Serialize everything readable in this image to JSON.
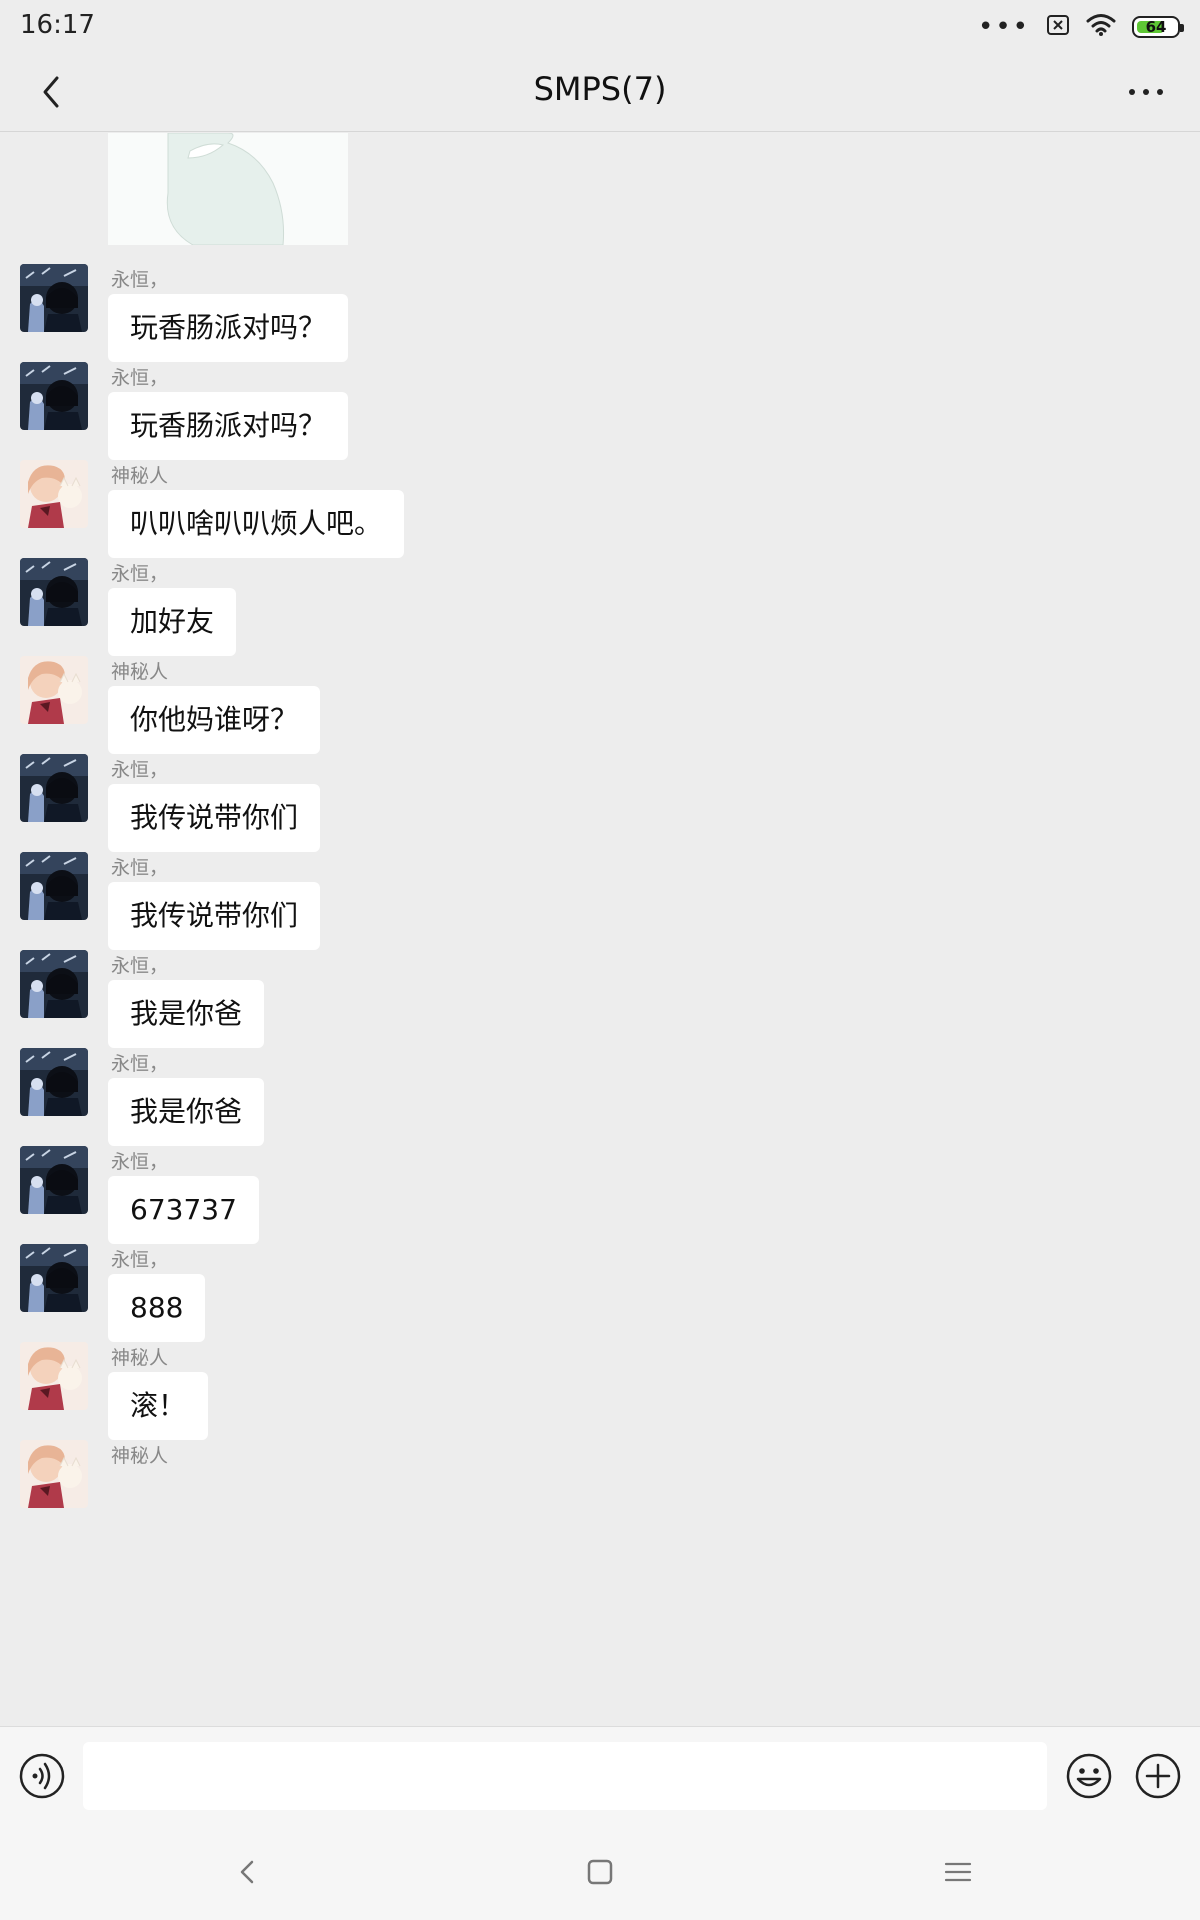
{
  "status_bar": {
    "time": "16:17",
    "overflow_dots": "•••",
    "battery_level": "64"
  },
  "header": {
    "title": "SMPS(7)"
  },
  "messages": [
    {
      "sender": "永恒，",
      "text": "玩香肠派对吗？",
      "avatar": "avatar-dark"
    },
    {
      "sender": "永恒，",
      "text": "玩香肠派对吗？",
      "avatar": "avatar-dark"
    },
    {
      "sender": "神秘人",
      "text": "叭叭啥叭叭烦人吧。",
      "avatar": "avatar-pink"
    },
    {
      "sender": "永恒，",
      "text": "加好友",
      "avatar": "avatar-dark"
    },
    {
      "sender": "神秘人",
      "text": "你他妈谁呀？",
      "avatar": "avatar-pink"
    },
    {
      "sender": "永恒，",
      "text": "我传说带你们",
      "avatar": "avatar-dark"
    },
    {
      "sender": "永恒，",
      "text": "我传说带你们",
      "avatar": "avatar-dark"
    },
    {
      "sender": "永恒，",
      "text": "我是你爸",
      "avatar": "avatar-dark"
    },
    {
      "sender": "永恒，",
      "text": "我是你爸",
      "avatar": "avatar-dark"
    },
    {
      "sender": "永恒，",
      "text": "673737",
      "avatar": "avatar-dark"
    },
    {
      "sender": "永恒，",
      "text": "888",
      "avatar": "avatar-dark"
    },
    {
      "sender": "神秘人",
      "text": "滚！",
      "avatar": "avatar-pink"
    },
    {
      "sender": "神秘人",
      "text": "",
      "avatar": "avatar-pink"
    }
  ],
  "input_bar": {
    "input_value": ""
  },
  "icons": {
    "back": "chevron-left-icon",
    "more": "more-dots-icon",
    "voice": "voice-icon",
    "emoji": "emoji-icon",
    "plus": "plus-icon"
  },
  "colors": {
    "background": "#ededed",
    "bubble": "#ffffff",
    "battery_fill": "#5ec735",
    "sender_text": "#888888"
  }
}
